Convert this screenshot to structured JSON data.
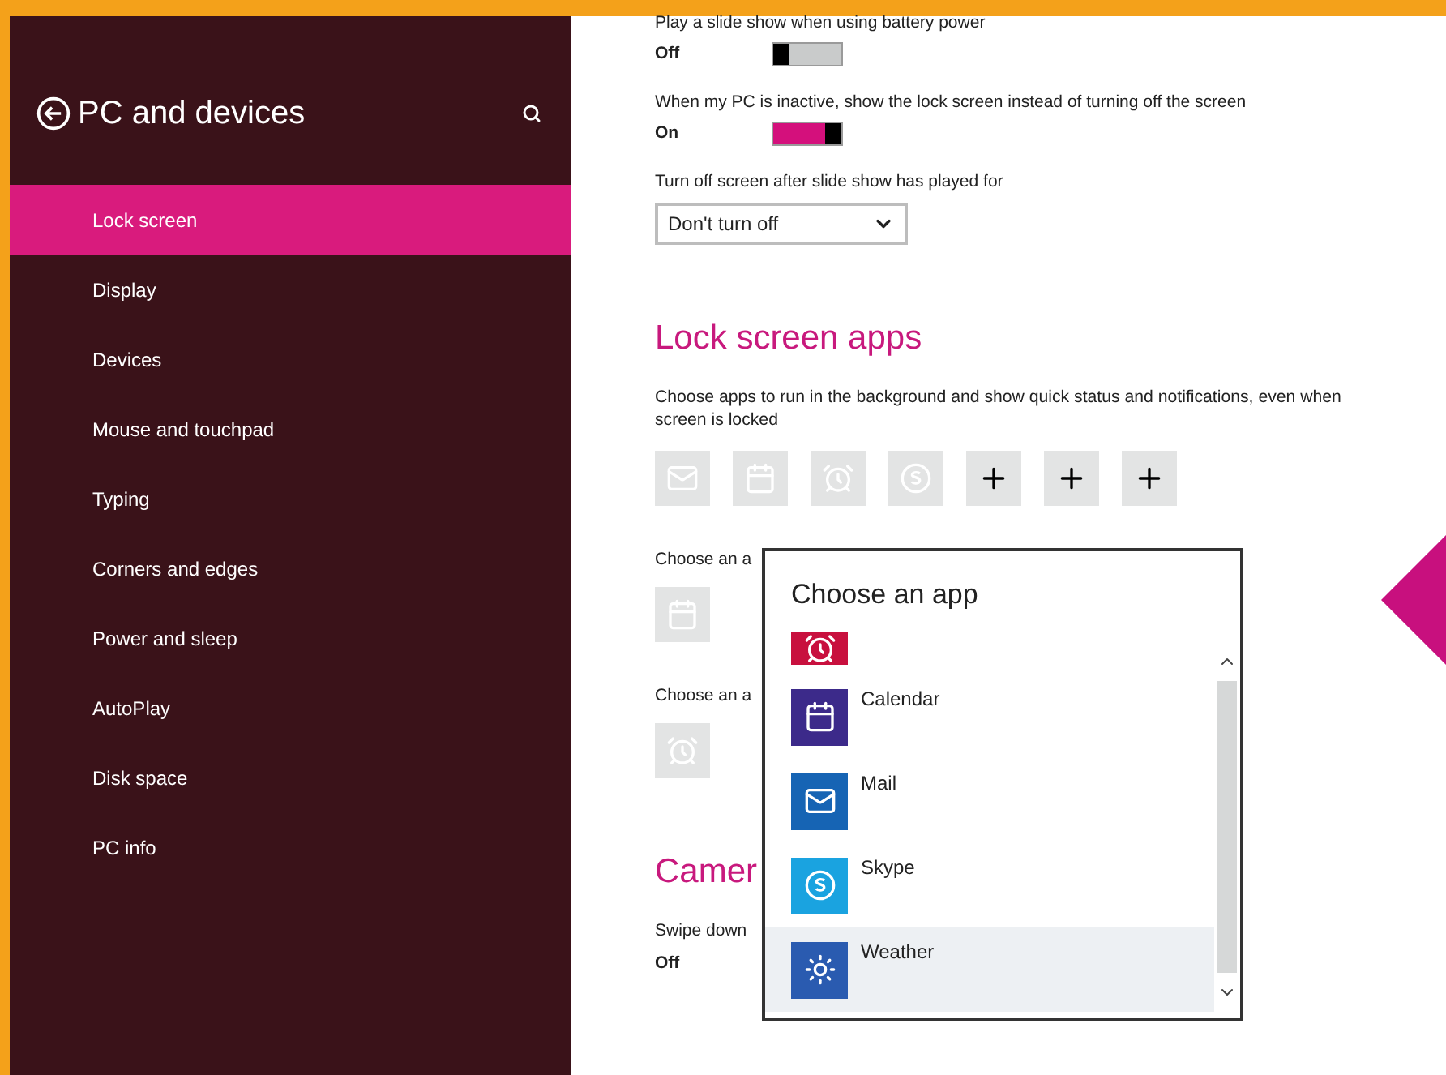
{
  "sidebar": {
    "title": "PC and devices",
    "items": [
      {
        "label": "Lock screen",
        "selected": true
      },
      {
        "label": "Display",
        "selected": false
      },
      {
        "label": "Devices",
        "selected": false
      },
      {
        "label": "Mouse and touchpad",
        "selected": false
      },
      {
        "label": "Typing",
        "selected": false
      },
      {
        "label": "Corners and edges",
        "selected": false
      },
      {
        "label": "Power and sleep",
        "selected": false
      },
      {
        "label": "AutoPlay",
        "selected": false
      },
      {
        "label": "Disk space",
        "selected": false
      },
      {
        "label": "PC info",
        "selected": false
      }
    ]
  },
  "settings": [
    {
      "label": "Play a slide show when using battery power",
      "state": "Off",
      "on": false
    },
    {
      "label": "When my PC is inactive, show the lock screen instead of turning off the screen",
      "state": "On",
      "on": true
    }
  ],
  "slideshow_timeout": {
    "label": "Turn off screen after slide show has played for",
    "value": "Don't turn off"
  },
  "lock_screen_apps": {
    "heading": "Lock screen apps",
    "description": [
      "Choose apps to run in the background and show quick status and notifications, even when",
      "screen is locked"
    ],
    "slots": [
      {
        "kind": "mail"
      },
      {
        "kind": "calendar"
      },
      {
        "kind": "alarm"
      },
      {
        "kind": "skype"
      },
      {
        "kind": "add"
      },
      {
        "kind": "add"
      },
      {
        "kind": "add"
      }
    ],
    "detailed_status": {
      "label": "Choose an a",
      "kind": "calendar"
    },
    "alarm": {
      "label": "Choose an a",
      "kind": "alarm"
    }
  },
  "camera": {
    "heading": "Camer",
    "label": "Swipe down",
    "state": "Off"
  },
  "popup": {
    "title": "Choose an app",
    "apps": [
      {
        "kind": "alarm",
        "color": "#c8103e",
        "selected": false
      },
      {
        "name": "Calendar",
        "kind": "calendar",
        "color": "#3c2a8a",
        "selected": false
      },
      {
        "name": "Mail",
        "kind": "mail",
        "color": "#1664b4",
        "selected": false
      },
      {
        "name": "Skype",
        "kind": "skype",
        "color": "#1aa3e0",
        "selected": false
      },
      {
        "name": "Weather",
        "kind": "weather",
        "color": "#2a5bb0",
        "selected": true
      }
    ]
  }
}
